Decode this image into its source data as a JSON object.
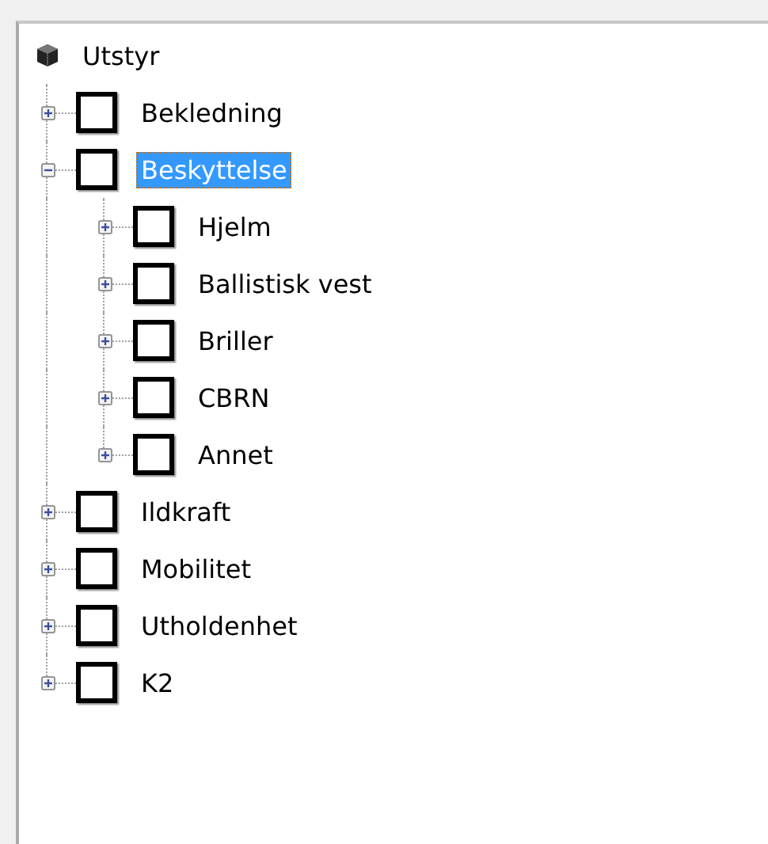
{
  "tree": {
    "label": "Utstyr",
    "children": [
      {
        "label": "Bekledning",
        "checked": false,
        "expanded": false,
        "selected": false
      },
      {
        "label": "Beskyttelse",
        "checked": false,
        "expanded": true,
        "selected": true,
        "children": [
          {
            "label": "Hjelm",
            "checked": false,
            "expanded": false,
            "selected": false
          },
          {
            "label": "Ballistisk vest",
            "checked": false,
            "expanded": false,
            "selected": false
          },
          {
            "label": "Briller",
            "checked": false,
            "expanded": false,
            "selected": false
          },
          {
            "label": "CBRN",
            "checked": false,
            "expanded": false,
            "selected": false
          },
          {
            "label": "Annet",
            "checked": false,
            "expanded": false,
            "selected": false
          }
        ]
      },
      {
        "label": "Ildkraft",
        "checked": false,
        "expanded": false,
        "selected": false
      },
      {
        "label": "Mobilitet",
        "checked": false,
        "expanded": false,
        "selected": false
      },
      {
        "label": "Utholdenhet",
        "checked": false,
        "expanded": false,
        "selected": false
      },
      {
        "label": "K2",
        "checked": false,
        "expanded": false,
        "selected": false
      }
    ]
  }
}
